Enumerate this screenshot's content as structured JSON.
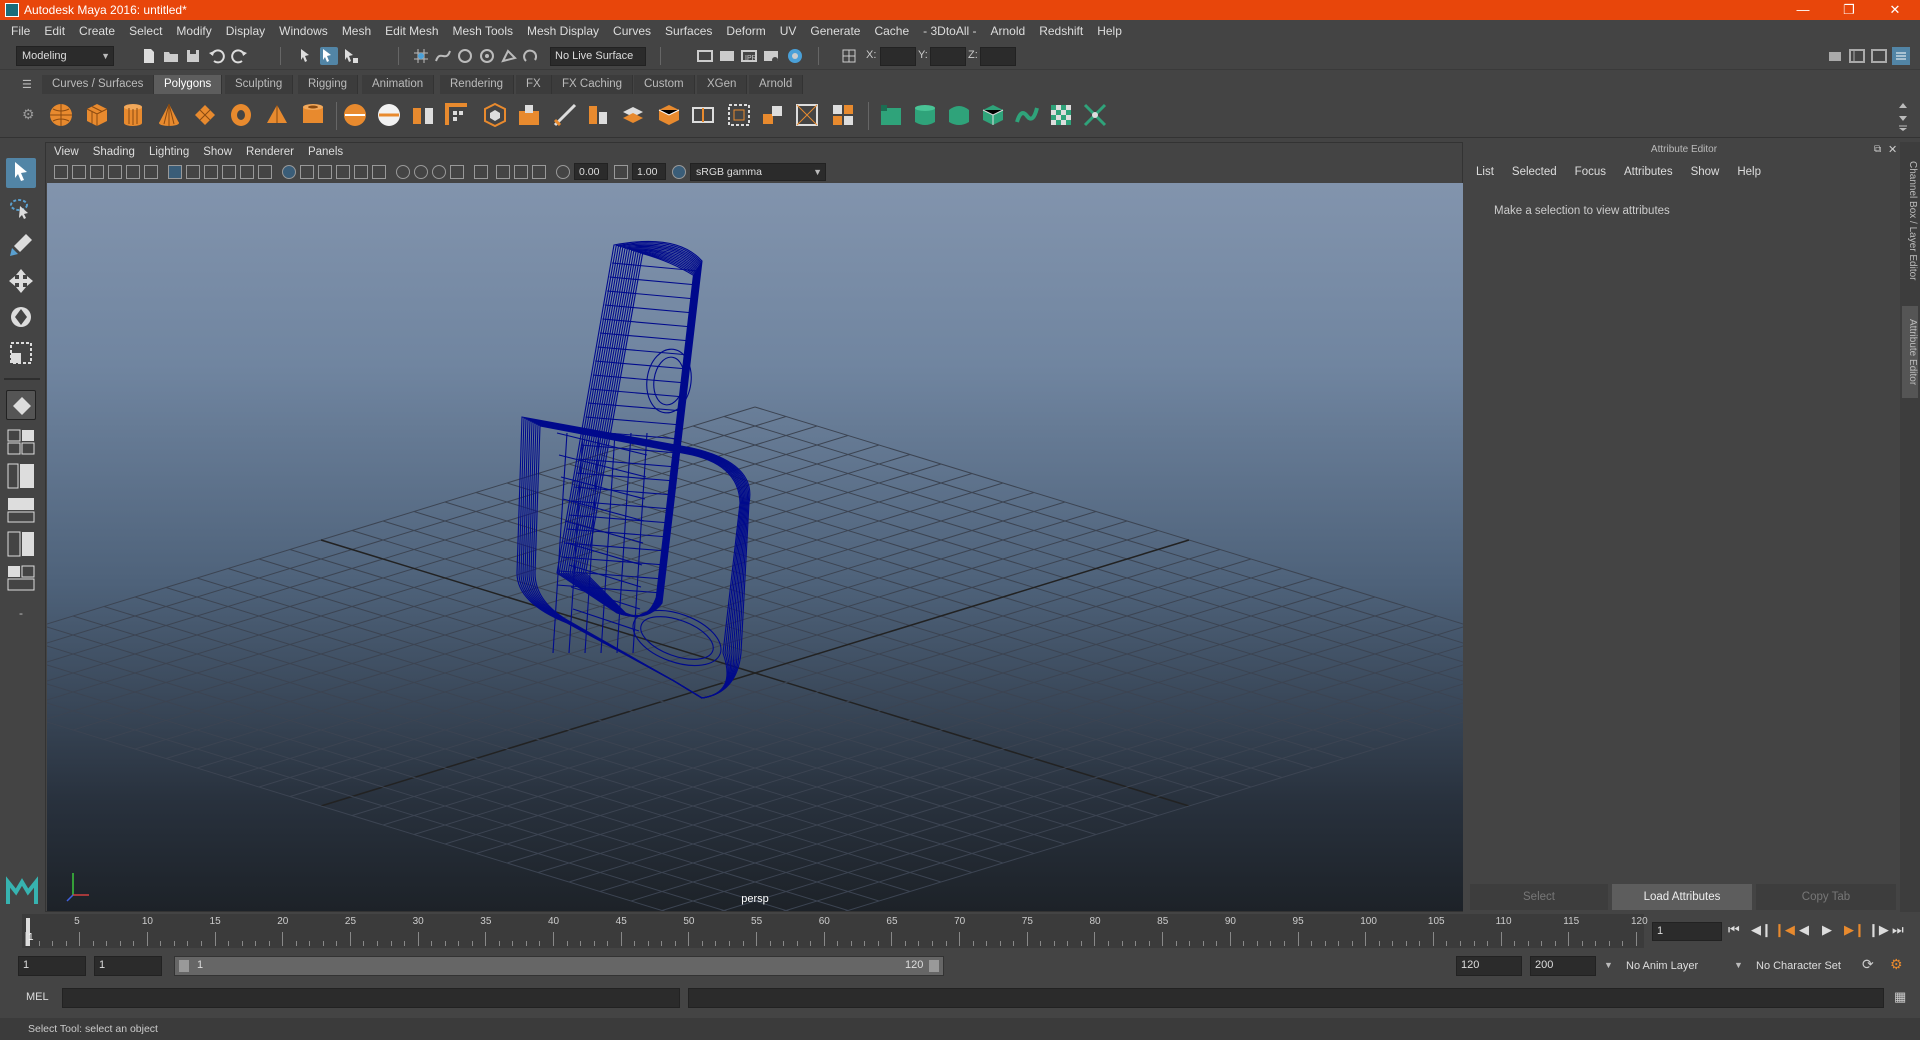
{
  "window": {
    "title": "Autodesk Maya 2016: untitled*"
  },
  "menu": [
    "File",
    "Edit",
    "Create",
    "Select",
    "Modify",
    "Display",
    "Windows",
    "Mesh",
    "Edit Mesh",
    "Mesh Tools",
    "Mesh Display",
    "Curves",
    "Surfaces",
    "Deform",
    "UV",
    "Generate",
    "Cache",
    "- 3DtoAll -",
    "Arnold",
    "Redshift",
    "Help"
  ],
  "status_line": {
    "menu_set": "Modeling",
    "live_surface": "No Live Surface",
    "x_label": "X:",
    "y_label": "Y:",
    "z_label": "Z:"
  },
  "shelf": {
    "tabs": [
      "Curves / Surfaces",
      "Polygons",
      "Sculpting",
      "Rigging",
      "Animation",
      "Rendering",
      "FX",
      "FX Caching",
      "Custom",
      "XGen",
      "Arnold"
    ],
    "active_tab": "Polygons"
  },
  "viewport": {
    "menu": [
      "View",
      "Shading",
      "Lighting",
      "Show",
      "Renderer",
      "Panels"
    ],
    "exposure": "0.00",
    "gamma": "1.00",
    "color_space": "sRGB gamma",
    "camera_label": "persp"
  },
  "attribute_editor": {
    "title": "Attribute Editor",
    "menu": [
      "List",
      "Selected",
      "Focus",
      "Attributes",
      "Show",
      "Help"
    ],
    "message": "Make a selection to view attributes",
    "buttons": {
      "select": "Select",
      "load": "Load Attributes",
      "copy": "Copy Tab"
    }
  },
  "side_tabs": {
    "channel_box": "Channel Box / Layer Editor",
    "attribute_editor": "Attribute Editor"
  },
  "time_slider": {
    "tick_labels": [
      "1",
      "5",
      "10",
      "15",
      "20",
      "25",
      "30",
      "35",
      "40",
      "45",
      "50",
      "55",
      "60",
      "65",
      "70",
      "75",
      "80",
      "85",
      "90",
      "95",
      "100",
      "105",
      "110",
      "115",
      "120"
    ],
    "current_frame": "1"
  },
  "range_slider": {
    "start": "1",
    "anim_start": "1",
    "range_start": "1",
    "range_end": "120",
    "anim_end": "120",
    "end": "200",
    "anim_layer": "No Anim Layer",
    "character_set": "No Character Set"
  },
  "command_line": {
    "language": "MEL"
  },
  "help_line": {
    "text": "Select Tool: select an object"
  },
  "colors": {
    "title_bar": "#e8460b",
    "wireframe": "#000a8c",
    "shelf_orange": "#e88a2e",
    "shelf_green": "#2fa37a"
  }
}
